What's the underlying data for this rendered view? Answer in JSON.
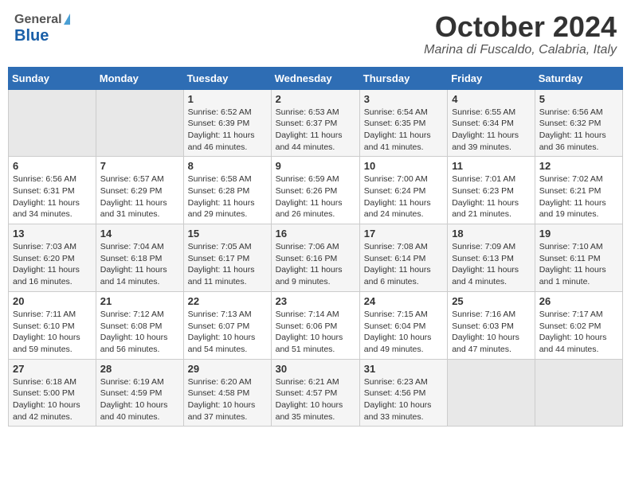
{
  "header": {
    "logo_general": "General",
    "logo_blue": "Blue",
    "month_title": "October 2024",
    "location": "Marina di Fuscaldo, Calabria, Italy"
  },
  "weekdays": [
    "Sunday",
    "Monday",
    "Tuesday",
    "Wednesday",
    "Thursday",
    "Friday",
    "Saturday"
  ],
  "weeks": [
    [
      {
        "day": "",
        "empty": true
      },
      {
        "day": "",
        "empty": true
      },
      {
        "day": "1",
        "sunrise": "6:52 AM",
        "sunset": "6:39 PM",
        "daylight": "11 hours and 46 minutes."
      },
      {
        "day": "2",
        "sunrise": "6:53 AM",
        "sunset": "6:37 PM",
        "daylight": "11 hours and 44 minutes."
      },
      {
        "day": "3",
        "sunrise": "6:54 AM",
        "sunset": "6:35 PM",
        "daylight": "11 hours and 41 minutes."
      },
      {
        "day": "4",
        "sunrise": "6:55 AM",
        "sunset": "6:34 PM",
        "daylight": "11 hours and 39 minutes."
      },
      {
        "day": "5",
        "sunrise": "6:56 AM",
        "sunset": "6:32 PM",
        "daylight": "11 hours and 36 minutes."
      }
    ],
    [
      {
        "day": "6",
        "sunrise": "6:56 AM",
        "sunset": "6:31 PM",
        "daylight": "11 hours and 34 minutes."
      },
      {
        "day": "7",
        "sunrise": "6:57 AM",
        "sunset": "6:29 PM",
        "daylight": "11 hours and 31 minutes."
      },
      {
        "day": "8",
        "sunrise": "6:58 AM",
        "sunset": "6:28 PM",
        "daylight": "11 hours and 29 minutes."
      },
      {
        "day": "9",
        "sunrise": "6:59 AM",
        "sunset": "6:26 PM",
        "daylight": "11 hours and 26 minutes."
      },
      {
        "day": "10",
        "sunrise": "7:00 AM",
        "sunset": "6:24 PM",
        "daylight": "11 hours and 24 minutes."
      },
      {
        "day": "11",
        "sunrise": "7:01 AM",
        "sunset": "6:23 PM",
        "daylight": "11 hours and 21 minutes."
      },
      {
        "day": "12",
        "sunrise": "7:02 AM",
        "sunset": "6:21 PM",
        "daylight": "11 hours and 19 minutes."
      }
    ],
    [
      {
        "day": "13",
        "sunrise": "7:03 AM",
        "sunset": "6:20 PM",
        "daylight": "11 hours and 16 minutes."
      },
      {
        "day": "14",
        "sunrise": "7:04 AM",
        "sunset": "6:18 PM",
        "daylight": "11 hours and 14 minutes."
      },
      {
        "day": "15",
        "sunrise": "7:05 AM",
        "sunset": "6:17 PM",
        "daylight": "11 hours and 11 minutes."
      },
      {
        "day": "16",
        "sunrise": "7:06 AM",
        "sunset": "6:16 PM",
        "daylight": "11 hours and 9 minutes."
      },
      {
        "day": "17",
        "sunrise": "7:08 AM",
        "sunset": "6:14 PM",
        "daylight": "11 hours and 6 minutes."
      },
      {
        "day": "18",
        "sunrise": "7:09 AM",
        "sunset": "6:13 PM",
        "daylight": "11 hours and 4 minutes."
      },
      {
        "day": "19",
        "sunrise": "7:10 AM",
        "sunset": "6:11 PM",
        "daylight": "11 hours and 1 minute."
      }
    ],
    [
      {
        "day": "20",
        "sunrise": "7:11 AM",
        "sunset": "6:10 PM",
        "daylight": "10 hours and 59 minutes."
      },
      {
        "day": "21",
        "sunrise": "7:12 AM",
        "sunset": "6:08 PM",
        "daylight": "10 hours and 56 minutes."
      },
      {
        "day": "22",
        "sunrise": "7:13 AM",
        "sunset": "6:07 PM",
        "daylight": "10 hours and 54 minutes."
      },
      {
        "day": "23",
        "sunrise": "7:14 AM",
        "sunset": "6:06 PM",
        "daylight": "10 hours and 51 minutes."
      },
      {
        "day": "24",
        "sunrise": "7:15 AM",
        "sunset": "6:04 PM",
        "daylight": "10 hours and 49 minutes."
      },
      {
        "day": "25",
        "sunrise": "7:16 AM",
        "sunset": "6:03 PM",
        "daylight": "10 hours and 47 minutes."
      },
      {
        "day": "26",
        "sunrise": "7:17 AM",
        "sunset": "6:02 PM",
        "daylight": "10 hours and 44 minutes."
      }
    ],
    [
      {
        "day": "27",
        "sunrise": "6:18 AM",
        "sunset": "5:00 PM",
        "daylight": "10 hours and 42 minutes."
      },
      {
        "day": "28",
        "sunrise": "6:19 AM",
        "sunset": "4:59 PM",
        "daylight": "10 hours and 40 minutes."
      },
      {
        "day": "29",
        "sunrise": "6:20 AM",
        "sunset": "4:58 PM",
        "daylight": "10 hours and 37 minutes."
      },
      {
        "day": "30",
        "sunrise": "6:21 AM",
        "sunset": "4:57 PM",
        "daylight": "10 hours and 35 minutes."
      },
      {
        "day": "31",
        "sunrise": "6:23 AM",
        "sunset": "4:56 PM",
        "daylight": "10 hours and 33 minutes."
      },
      {
        "day": "",
        "empty": true
      },
      {
        "day": "",
        "empty": true
      }
    ]
  ],
  "labels": {
    "sunrise": "Sunrise:",
    "sunset": "Sunset:",
    "daylight": "Daylight:"
  }
}
